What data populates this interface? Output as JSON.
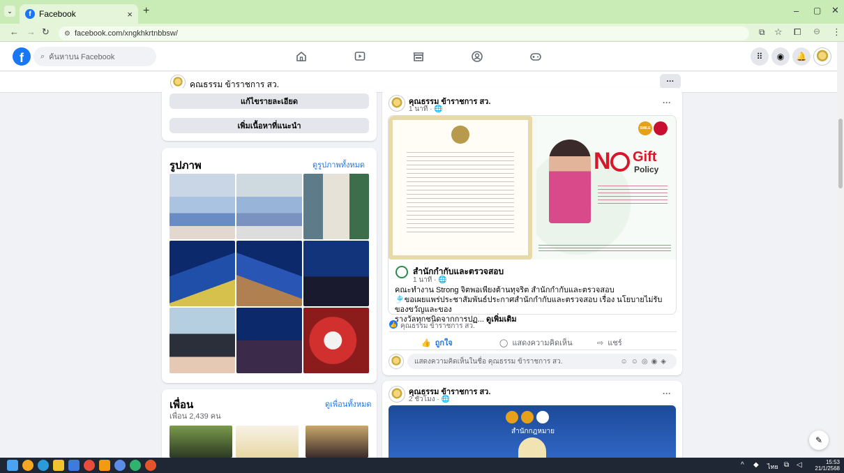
{
  "browser": {
    "tab_title": "Facebook",
    "new_tab": "+",
    "url": "facebook.com/xngkhkrtnbbsw/",
    "window_controls": [
      "–",
      "▢",
      "✕"
    ]
  },
  "fb": {
    "logo": "f",
    "search_placeholder": "ค้นหาบน Facebook",
    "page_name": "คุณธรรม ข้าราชการ สว.",
    "more_button": "···"
  },
  "left": {
    "edit_details": "แก้ไขรายละเอียด",
    "add_featured": "เพิ่มเนื้อหาที่แนะนำ",
    "photos_title": "รูปภาพ",
    "photos_link": "ดูรูปภาพทั้งหมด",
    "friends_title": "เพื่อน",
    "friends_link": "ดูเพื่อนทั้งหมด",
    "friends_count": "เพื่อน 2,439 คน"
  },
  "post1": {
    "author": "คุณธรรม ข้าราชการ สว.",
    "time": "1 นาที · 🌐",
    "shared_author": "สำนักกำกับและตรวจสอบ",
    "shared_time": "1 นาที · 🌐",
    "text_line1": "คณะทำงาน Strong จิตพอเพียงต้านทุจริต สำนักกำกับและตรวจสอบ",
    "text_line2": "🎐ขอเผยแพร่ประชาสัมพันธ์ประกาศสำนักกำกับและตรวจสอบ เรื่อง นโยบายไม่รับของขวัญและของ",
    "text_line3": "รางวัลทุกชนิดจากการปฏ...",
    "see_more": "ดูเพิ่มเติม",
    "reaction_name": "คุณธรรม ข้าราชการ สว.",
    "like": "ถูกใจ",
    "comment": "แสดงความคิดเห็น",
    "share": "แชร์",
    "comment_placeholder": "แสดงความคิดเห็นในชื่อ คุณธรรม ข้าราชการ สว.",
    "image_title_no": "N",
    "image_title_gift": "Gift",
    "image_title_policy": "Policy",
    "badge": "SMILE"
  },
  "post2": {
    "author": "คุณธรรม ข้าราชการ สว.",
    "time": "2 ชั่วโมง · 🌐",
    "image_caption": "สำนักกฎหมาย"
  },
  "taskbar": {
    "time": "15:53",
    "date": "21/1/2568",
    "lang": "ไทย"
  }
}
